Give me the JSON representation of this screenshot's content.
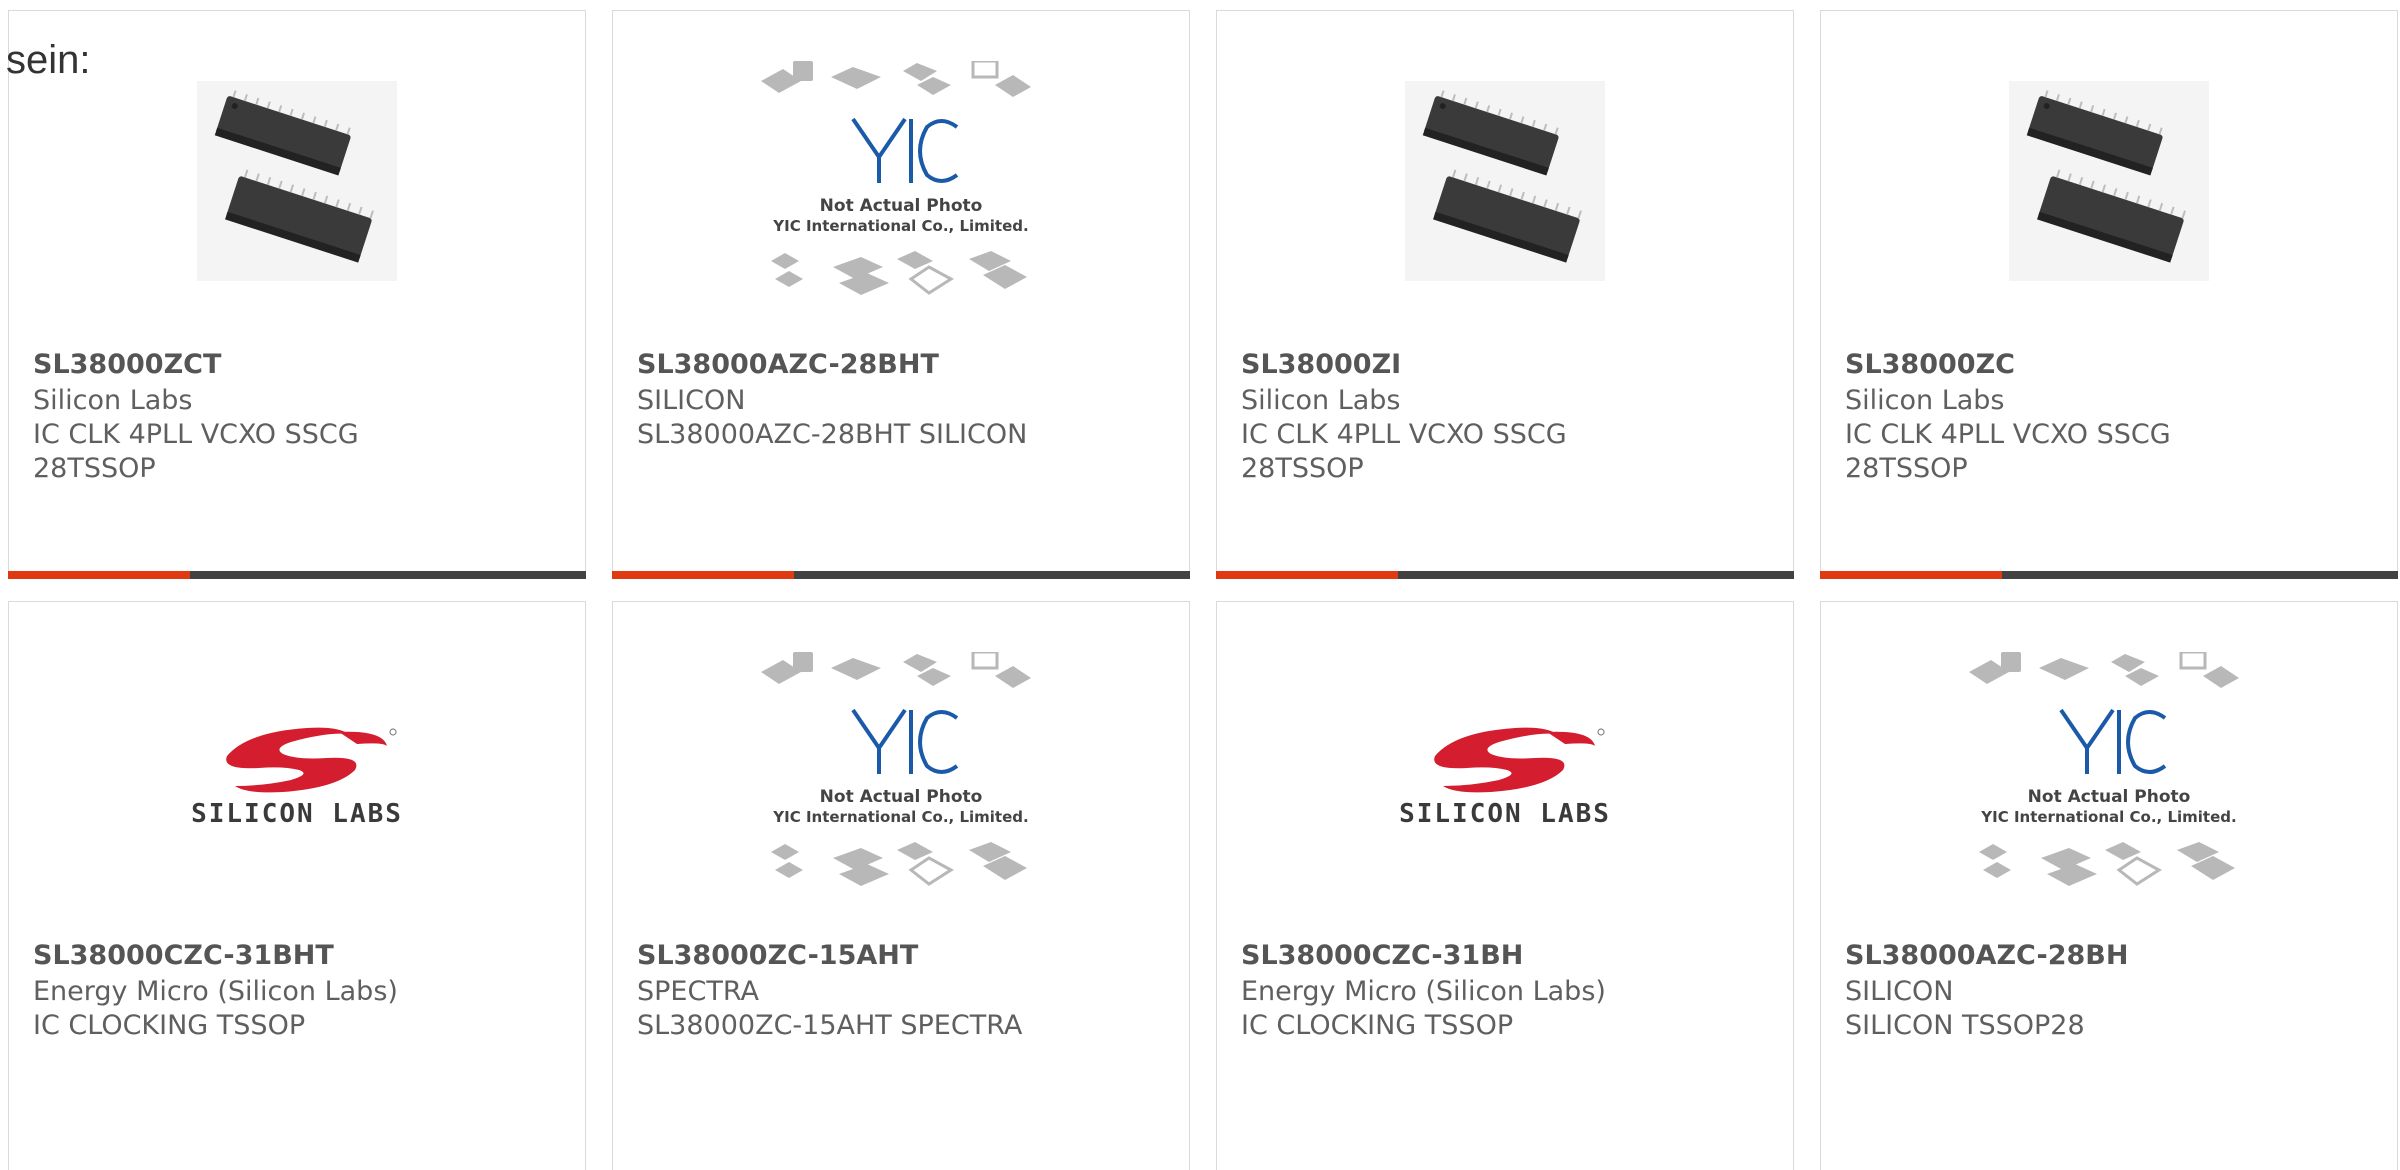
{
  "partial_text": "sein:",
  "colors": {
    "accent": "#e03a12",
    "bar_dark": "#424242",
    "card_border": "#dadada",
    "text": "#5f5f5f",
    "silicon_red": "#d41e2f",
    "yic_blue": "#1a5aa8"
  },
  "cards": [
    {
      "image_type": "chip-photo",
      "part": "SL38000ZCT",
      "manufacturer": "Silicon Labs",
      "description": "IC CLK 4PLL VCXO SSCG",
      "description2": "28TSSOP"
    },
    {
      "image_type": "yic-placeholder",
      "image_text1": "Not Actual Photo",
      "image_text2": "YIC International Co., Limited.",
      "part": "SL38000AZC-28BHT",
      "manufacturer": "SILICON",
      "description": "SL38000AZC-28BHT SILICON",
      "description2": ""
    },
    {
      "image_type": "chip-photo",
      "part": "SL38000ZI",
      "manufacturer": "Silicon Labs",
      "description": "IC CLK 4PLL VCXO SSCG",
      "description2": "28TSSOP"
    },
    {
      "image_type": "chip-photo",
      "part": "SL38000ZC",
      "manufacturer": "Silicon Labs",
      "description": "IC CLK 4PLL VCXO SSCG",
      "description2": "28TSSOP"
    },
    {
      "image_type": "silicon-labs-logo",
      "image_text1": "SILICON LABS",
      "part": "SL38000CZC-31BHT",
      "manufacturer": "Energy Micro (Silicon Labs)",
      "description": "IC CLOCKING TSSOP",
      "description2": ""
    },
    {
      "image_type": "yic-placeholder",
      "image_text1": "Not Actual Photo",
      "image_text2": "YIC International Co., Limited.",
      "part": "SL38000ZC-15AHT",
      "manufacturer": "SPECTRA",
      "description": "SL38000ZC-15AHT SPECTRA",
      "description2": ""
    },
    {
      "image_type": "silicon-labs-logo",
      "image_text1": "SILICON LABS",
      "part": "SL38000CZC-31BH",
      "manufacturer": "Energy Micro (Silicon Labs)",
      "description": "IC CLOCKING TSSOP",
      "description2": ""
    },
    {
      "image_type": "yic-placeholder",
      "image_text1": "Not Actual Photo",
      "image_text2": "YIC International Co., Limited.",
      "part": "SL38000AZC-28BH",
      "manufacturer": "SILICON",
      "description": "SILICON TSSOP28",
      "description2": ""
    }
  ]
}
